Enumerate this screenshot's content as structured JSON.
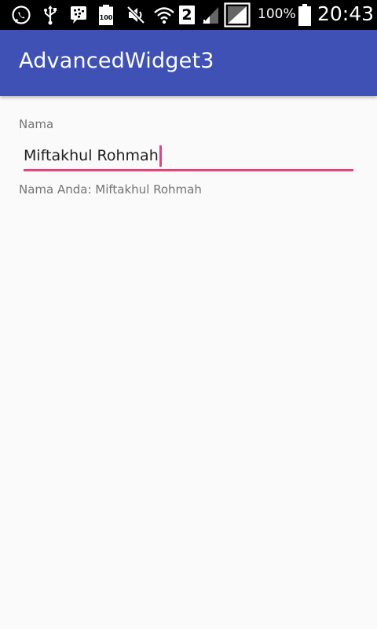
{
  "status_bar": {
    "icons": [
      "whatsapp-icon",
      "usb-icon",
      "bbm-icon",
      "battery-100-icon",
      "mute-icon",
      "wifi-icon",
      "sim-2-icon",
      "signal-icon",
      "screenshot-icon",
      "battery-icon"
    ],
    "sim_label": "2",
    "battery_percent": "100%",
    "time": "20:43"
  },
  "app_bar": {
    "title": "AdvancedWidget3",
    "color": "#3f51b5"
  },
  "form": {
    "label": "Nama",
    "input_value": "Miftakhul Rohmah",
    "accent_color": "#ec407a",
    "result_text": "Nama Anda: Miftakhul Rohmah"
  }
}
